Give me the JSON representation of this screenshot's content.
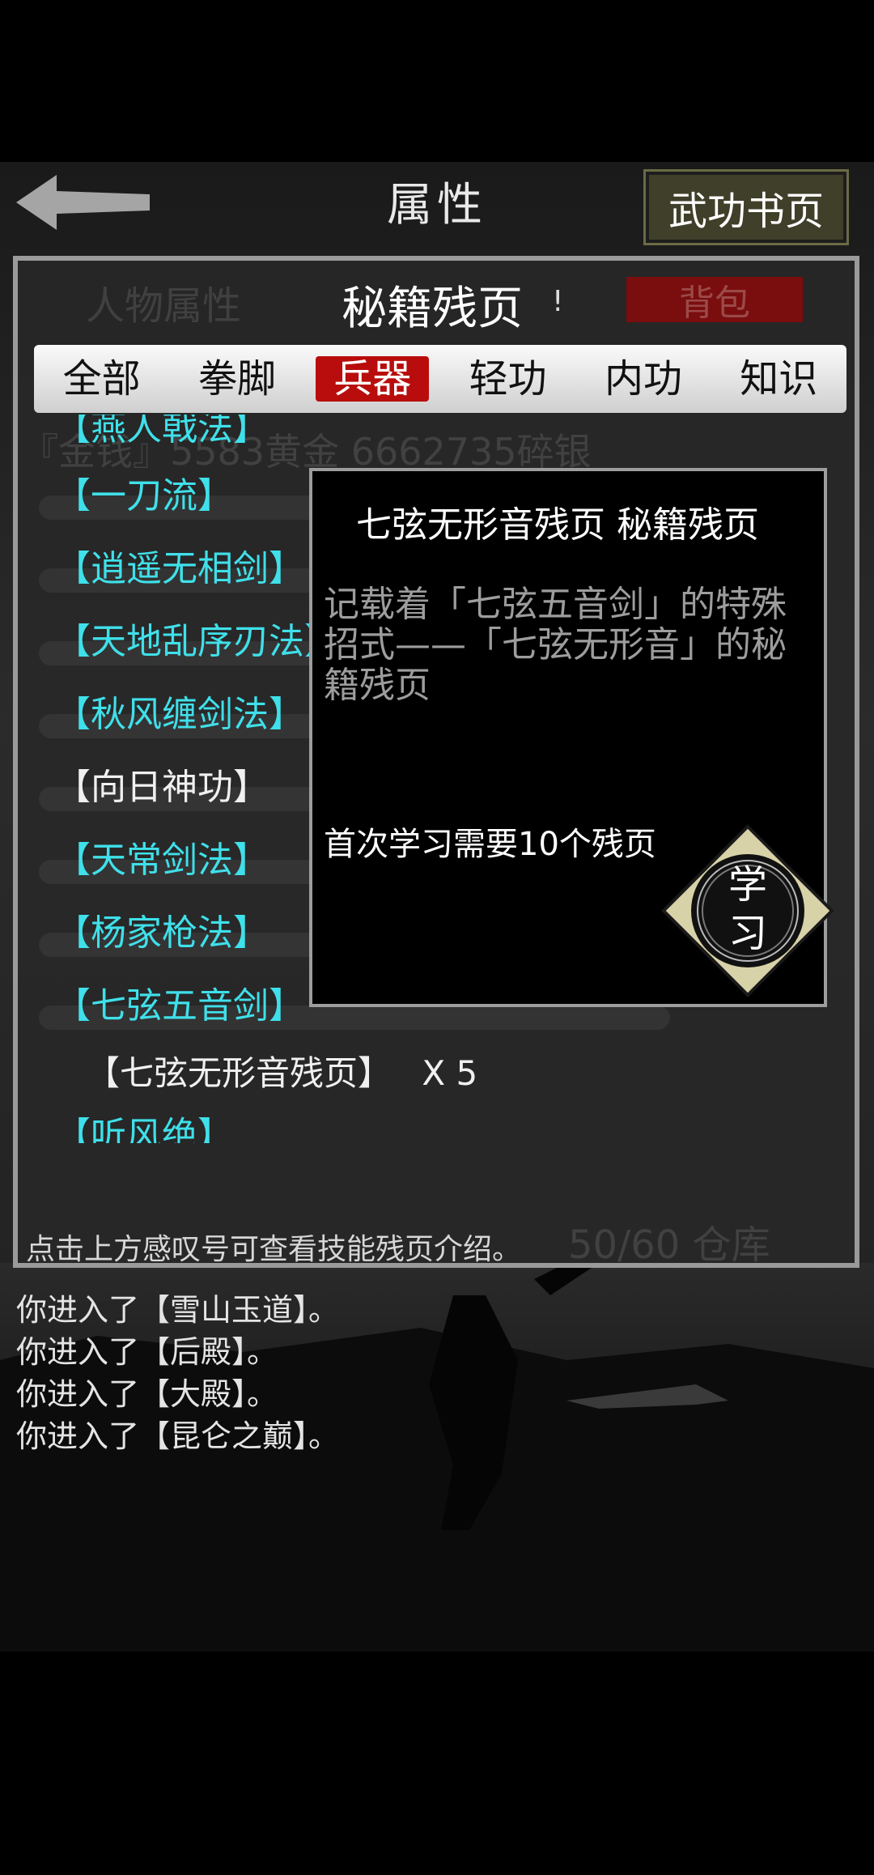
{
  "header": {
    "title": "属性",
    "skillbook_button": "武功书页"
  },
  "panel": {
    "ghost_tab": "人物属性",
    "title": "秘籍残页",
    "info_icon": "!",
    "bag_button": "背包",
    "ghost_money": "『金钱』5583黄金 6662735碎银",
    "tabs": [
      "全部",
      "拳脚",
      "兵器",
      "轻功",
      "内功",
      "知识"
    ],
    "active_tab": 2,
    "list_items": [
      {
        "label": "【燕人戟法】",
        "color": "cyan"
      },
      {
        "label": "【一刀流】",
        "color": "cyan"
      },
      {
        "label": "【逍遥无相剑】",
        "color": "cyan"
      },
      {
        "label": "【天地乱序刃法】",
        "color": "cyan"
      },
      {
        "label": "【秋风缠剑法】",
        "color": "cyan"
      },
      {
        "label": "【向日神功】",
        "color": "white"
      },
      {
        "label": "【天常剑法】",
        "color": "cyan"
      },
      {
        "label": "【杨家枪法】",
        "color": "cyan"
      },
      {
        "label": "【七弦五音剑】",
        "color": "cyan"
      },
      {
        "label": "【听风绝】",
        "color": "cyan"
      }
    ],
    "sub_item": {
      "label": "【七弦无形音残页】",
      "count": "X 5"
    },
    "hint": "点击上方感叹号可查看技能残页介绍。",
    "ghost_storage": "50/60 仓库"
  },
  "popup": {
    "title": "七弦无形音残页 秘籍残页",
    "description": "记载着「七弦五音剑」的特殊招式——「七弦无形音」的秘籍残页",
    "requirement": "首次学习需要10个残页",
    "learn_button": [
      "学",
      "习"
    ]
  },
  "log": [
    "你进入了【雪山玉道】。",
    "你进入了【后殿】。",
    "你进入了【大殿】。",
    "你进入了【昆仑之巅】。"
  ],
  "colors": {
    "accent_red": "#b90d0d",
    "item_cyan": "#3fe0ea",
    "learn_button_bg": "#d8d2a8"
  }
}
